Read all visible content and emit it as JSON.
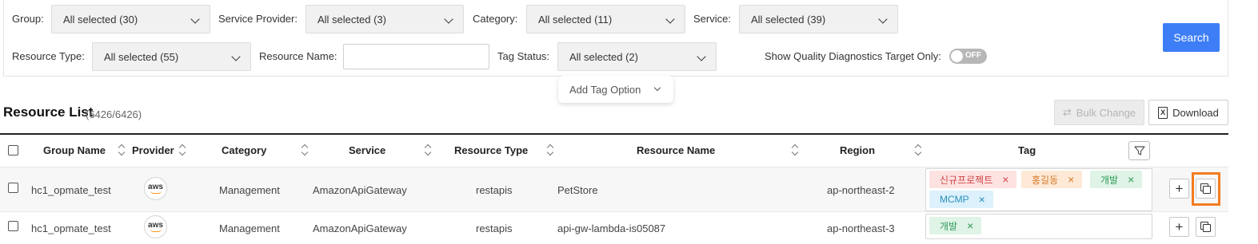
{
  "filters": {
    "group": {
      "label": "Group:",
      "value": "All selected (30)"
    },
    "service_provider": {
      "label": "Service Provider:",
      "value": "All selected (3)"
    },
    "category": {
      "label": "Category:",
      "value": "All selected (11)"
    },
    "service": {
      "label": "Service:",
      "value": "All selected (39)"
    },
    "resource_type": {
      "label": "Resource Type:",
      "value": "All selected (55)"
    },
    "resource_name": {
      "label": "Resource Name:",
      "value": ""
    },
    "tag_status": {
      "label": "Tag Status:",
      "value": "All selected (2)"
    },
    "quality_toggle": {
      "label": "Show Quality Diagnostics Target Only:",
      "state": "OFF"
    },
    "search_label": "Search",
    "add_tag_option": "Add Tag Option"
  },
  "resource_list": {
    "title": "Resource List",
    "count": "(6426/6426)",
    "bulk_change_label": "Bulk Change",
    "download_label": "Download",
    "columns": [
      "Group Name",
      "Provider",
      "Category",
      "Service",
      "Resource Type",
      "Resource Name",
      "Region",
      "Tag"
    ],
    "rows": [
      {
        "group": "hc1_opmate_test",
        "provider": "aws",
        "category": "Management",
        "service": "AmazonApiGateway",
        "resource_type": "restapis",
        "resource_name": "PetStore",
        "region": "ap-northeast-2",
        "tags": [
          "신규프로젝트",
          "홍길동",
          "개발",
          "MCMP"
        ]
      },
      {
        "group": "hc1_opmate_test",
        "provider": "aws",
        "category": "Management",
        "service": "AmazonApiGateway",
        "resource_type": "restapis",
        "resource_name": "api-gw-lambda-is05087",
        "region": "ap-northeast-3",
        "tags": [
          "개발"
        ]
      }
    ]
  },
  "icons": {
    "remove_tag": "×",
    "add": "+",
    "copy": "copy-icon",
    "filter": "filter-icon",
    "excel": "X"
  },
  "colors": {
    "primary": "#3d7ef7",
    "highlight": "#f47b20"
  }
}
